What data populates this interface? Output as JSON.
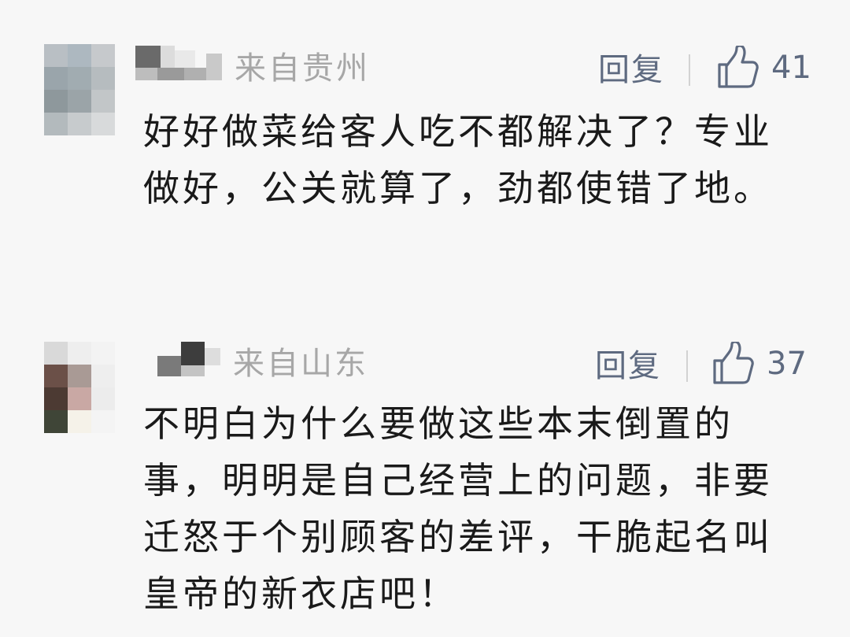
{
  "comments": [
    {
      "location": "来自贵州",
      "reply_label": "回复",
      "like_count": "41",
      "text": "好好做菜给客人吃不都解决了？专业做好，公关就算了，劲都使错了地。",
      "avatar_colors": [
        "#b9bfc4",
        "#adb8c0",
        "#c6c9cc",
        "#9aa5ab",
        "#a1acb1",
        "#b6bcbf",
        "#8e989c",
        "#9ba4a8",
        "#c2c6c8",
        "#b3babd",
        "#c7cbcd",
        "#d8dadb"
      ],
      "like_icon": "thumbs-up-icon"
    },
    {
      "location": "来自山东",
      "reply_label": "回复",
      "like_count": "37",
      "text": "不明白为什么要做这些本末倒置的事，明明是自己经营上的问题，非要迁怒于个别顾客的差评，干脆起名叫皇帝的新衣店吧！",
      "avatar_colors": [
        "#d9d9d9",
        "#eeeeee",
        "#f3f3f3",
        "#6b5048",
        "#a99a95",
        "#eeeeee",
        "#4c3a33",
        "#c9a8a4",
        "#ececec",
        "#3f4537",
        "#f5f2e9",
        "#f4f4f4"
      ],
      "like_icon": "thumbs-up-icon"
    }
  ]
}
